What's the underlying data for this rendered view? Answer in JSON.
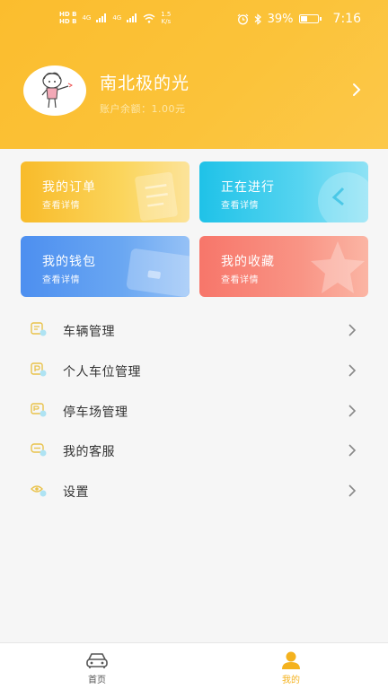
{
  "status_bar": {
    "hd1": "HD B",
    "hd2": "HD B",
    "net1": "4G",
    "net2": "4G",
    "speed_value": "1.5",
    "speed_unit": "K/s",
    "battery": "39%",
    "time": "7:16"
  },
  "profile": {
    "name": "南北极的光",
    "balance": "账户余额：1.00元"
  },
  "cards": [
    {
      "title": "我的订单",
      "sub": "查看详情"
    },
    {
      "title": "正在进行",
      "sub": "查看详情"
    },
    {
      "title": "我的钱包",
      "sub": "查看详情"
    },
    {
      "title": "我的收藏",
      "sub": "查看详情"
    }
  ],
  "menu": [
    {
      "label": "车辆管理",
      "icon": "car-doc-icon"
    },
    {
      "label": "个人车位管理",
      "icon": "parking-p-icon"
    },
    {
      "label": "停车场管理",
      "icon": "parking-lot-icon"
    },
    {
      "label": "我的客服",
      "icon": "service-chat-icon"
    },
    {
      "label": "设置",
      "icon": "settings-eye-icon"
    }
  ],
  "tabbar": {
    "home": "首页",
    "mine": "我的"
  },
  "colors": {
    "accent": "#fbbd2e",
    "tab_active": "#f4b21e",
    "menu_icon": "#e9c24a"
  }
}
